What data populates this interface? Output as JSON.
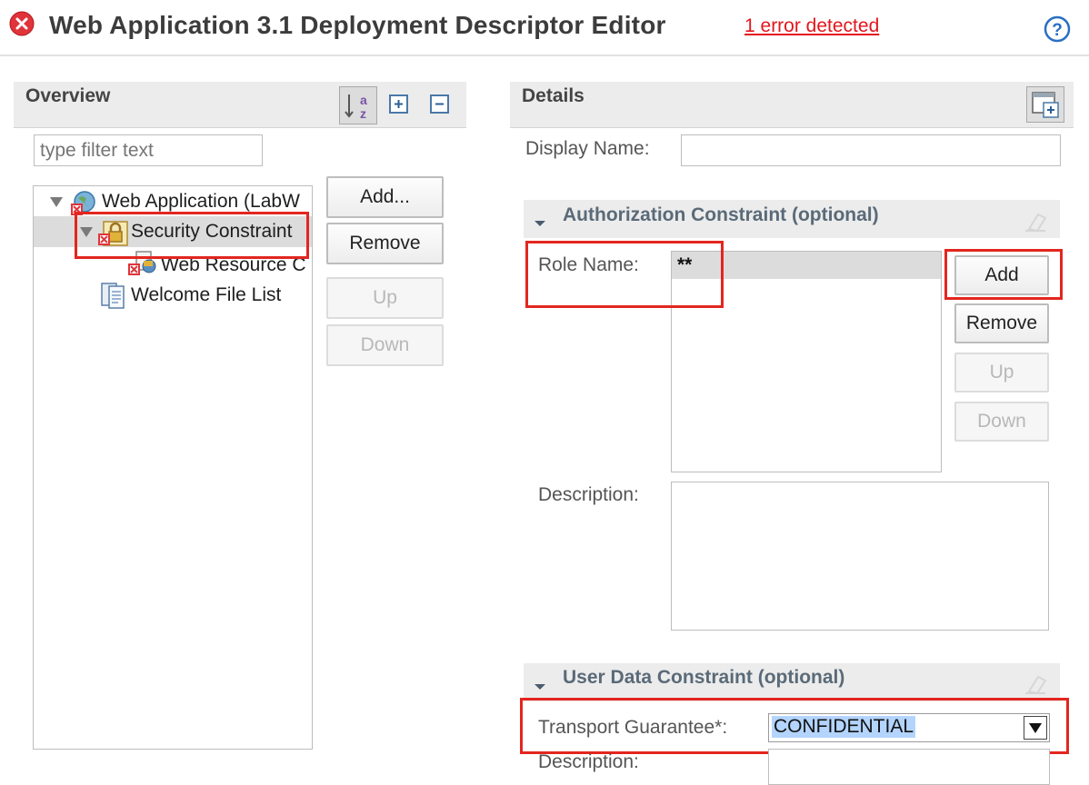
{
  "header": {
    "title": "Web Application 3.1 Deployment Descriptor Editor",
    "error_link": "1 error detected"
  },
  "overview": {
    "title": "Overview",
    "filter_placeholder": "type filter text",
    "tree": [
      {
        "label": "Web Application (LabW"
      },
      {
        "label": "Security Constraint"
      },
      {
        "label": "Web Resource C"
      },
      {
        "label": "Welcome File List"
      }
    ],
    "buttons": {
      "add": "Add...",
      "remove": "Remove",
      "up": "Up",
      "down": "Down"
    }
  },
  "details": {
    "title": "Details",
    "display_name_label": "Display Name:",
    "display_name_value": "",
    "authorization": {
      "title": "Authorization Constraint (optional)",
      "role_name_label": "Role Name:",
      "roles": [
        "**"
      ],
      "buttons": {
        "add": "Add",
        "remove": "Remove",
        "up": "Up",
        "down": "Down"
      },
      "description_label": "Description:",
      "description_value": ""
    },
    "user_data": {
      "title": "User Data Constraint (optional)",
      "transport_label": "Transport Guarantee*:",
      "transport_value": "CONFIDENTIAL",
      "description_label": "Description:"
    }
  },
  "colors": {
    "error": "#e4151d",
    "highlight_box": "#e3261f",
    "selection": "#b3d4fc"
  }
}
